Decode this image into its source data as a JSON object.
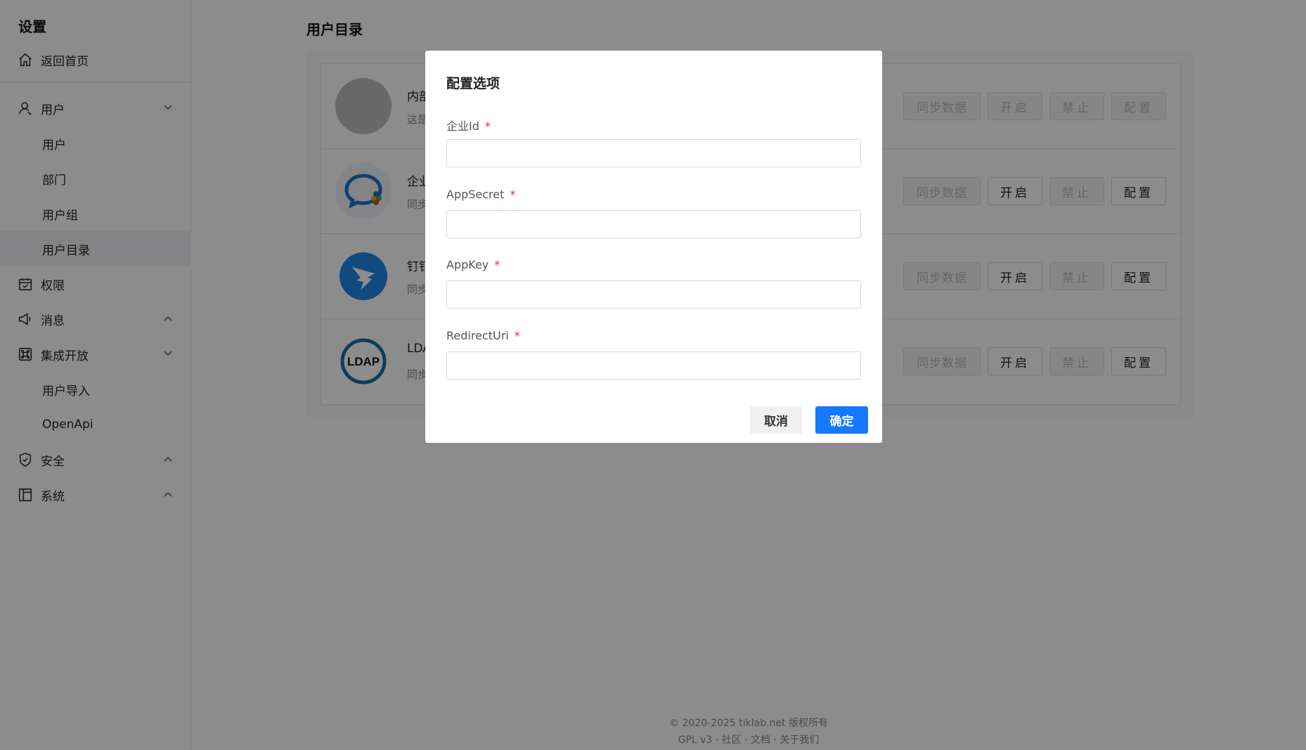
{
  "sidebar": {
    "title": "设置",
    "home": "返回首页",
    "groups": {
      "user": "用户",
      "permission": "权限",
      "message": "消息",
      "integration": "集成开放",
      "security": "安全",
      "system": "系统"
    },
    "user_items": [
      "用户",
      "部门",
      "用户组",
      "用户目录"
    ],
    "integration_items": [
      "用户导入",
      "OpenApi"
    ]
  },
  "main": {
    "title": "用户目录",
    "rows": [
      {
        "name": "内部",
        "desc": "这是",
        "buttons": [
          "同步数据",
          "开启",
          "禁止",
          "配置"
        ]
      },
      {
        "name": "企业",
        "desc": "同步",
        "buttons": [
          "同步数据",
          "开启",
          "禁止",
          "配置"
        ]
      },
      {
        "name": "钉钉",
        "desc": "同步",
        "buttons": [
          "同步数据",
          "开启",
          "禁止",
          "配置"
        ]
      },
      {
        "name": "LDA",
        "desc": "同步",
        "buttons": [
          "同步数据",
          "开启",
          "禁止",
          "配置"
        ],
        "logo_text": "LDAP"
      }
    ]
  },
  "footer": {
    "copyright": "© 2020-2025 tiklab.net 版权所有",
    "links": "GPL v3 · 社区 · 文档 · 关于我们"
  },
  "modal": {
    "title": "配置选项",
    "fields": [
      {
        "label": "企业Id",
        "required": "*",
        "value": ""
      },
      {
        "label": "AppSecret",
        "required": "*",
        "value": ""
      },
      {
        "label": "AppKey",
        "required": "*",
        "value": ""
      },
      {
        "label": "RedirectUri",
        "required": "*",
        "value": ""
      }
    ],
    "cancel": "取消",
    "ok": "确定"
  },
  "colors": {
    "primary": "#1677ff",
    "required": "#f5222d",
    "dingtalk": "#1e88e5",
    "ldap": "#1a6fa0"
  }
}
